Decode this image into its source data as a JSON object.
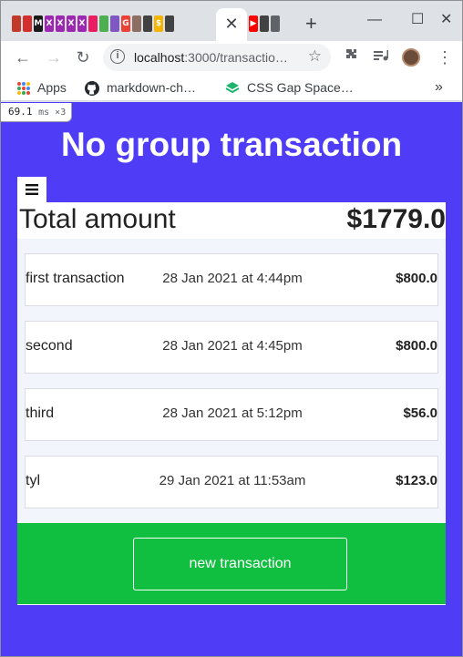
{
  "browser": {
    "tab_strip": {
      "favicons": [
        {
          "name": "tab-favicon-1",
          "color": "#c0392b",
          "glyph": ""
        },
        {
          "name": "tab-favicon-2",
          "color": "#d32f2f",
          "glyph": ""
        },
        {
          "name": "tab-favicon-3",
          "color": "#1a1a1a",
          "glyph": "M"
        },
        {
          "name": "tab-favicon-4",
          "color": "#9c27b0",
          "glyph": "X"
        },
        {
          "name": "tab-favicon-5",
          "color": "#9c27b0",
          "glyph": "X"
        },
        {
          "name": "tab-favicon-6",
          "color": "#9c27b0",
          "glyph": "X"
        },
        {
          "name": "tab-favicon-7",
          "color": "#9c27b0",
          "glyph": "X"
        },
        {
          "name": "tab-favicon-8",
          "color": "#e91e63",
          "glyph": ""
        },
        {
          "name": "tab-favicon-9",
          "color": "#4caf50",
          "glyph": ""
        },
        {
          "name": "tab-favicon-10",
          "color": "#7e57c2",
          "glyph": ""
        },
        {
          "name": "tab-favicon-11",
          "color": "#ea4335",
          "glyph": "G"
        },
        {
          "name": "tab-favicon-12",
          "color": "#8d6e63",
          "glyph": ""
        },
        {
          "name": "tab-favicon-13",
          "color": "#424242",
          "glyph": ""
        },
        {
          "name": "tab-favicon-14",
          "color": "#f4b400",
          "glyph": "$"
        },
        {
          "name": "tab-favicon-15",
          "color": "#424242",
          "glyph": ""
        }
      ],
      "active_tab_close": "✕",
      "after_tabs": [
        {
          "name": "tab-favicon-youtube",
          "color": "#ff0000",
          "glyph": "▶"
        },
        {
          "name": "tab-favicon-16",
          "color": "#424242",
          "glyph": ""
        },
        {
          "name": "tab-favicon-17",
          "color": "#5f6368",
          "glyph": ""
        }
      ],
      "new_tab": "+",
      "minimize": "—",
      "maximize": "☐",
      "close": "✕"
    },
    "toolbar": {
      "back": "←",
      "forward": "→",
      "reload": "↻",
      "url_host": "localhost",
      "url_path": ":3000/transactio…",
      "star": "☆",
      "extensions_icon": "puzzle-icon",
      "menu": "⋮"
    },
    "bookmarks": [
      {
        "label": "Apps"
      },
      {
        "label": "markdown-ch…"
      },
      {
        "label": "CSS Gap Space…"
      }
    ],
    "bookmarks_overflow": "»"
  },
  "devtools_timing": {
    "value": "69.1",
    "unit": "ms ×3"
  },
  "page": {
    "title": "No group transaction",
    "menu_button": "≡",
    "total_label": "Total amount",
    "total_value": "$1779.0",
    "transactions": [
      {
        "name": "first transaction",
        "date": "28 Jan 2021 at 4:44pm",
        "amount": "$800.0"
      },
      {
        "name": "second",
        "date": "28 Jan 2021 at 4:45pm",
        "amount": "$800.0"
      },
      {
        "name": "third",
        "date": "28 Jan 2021 at 5:12pm",
        "amount": "$56.0"
      },
      {
        "name": "tyl",
        "date": "29 Jan 2021 at 11:53am",
        "amount": "$123.0"
      }
    ],
    "new_button": "new transaction"
  },
  "colors": {
    "page_background": "#4e3cf7",
    "footer_band": "#10bf3f"
  }
}
